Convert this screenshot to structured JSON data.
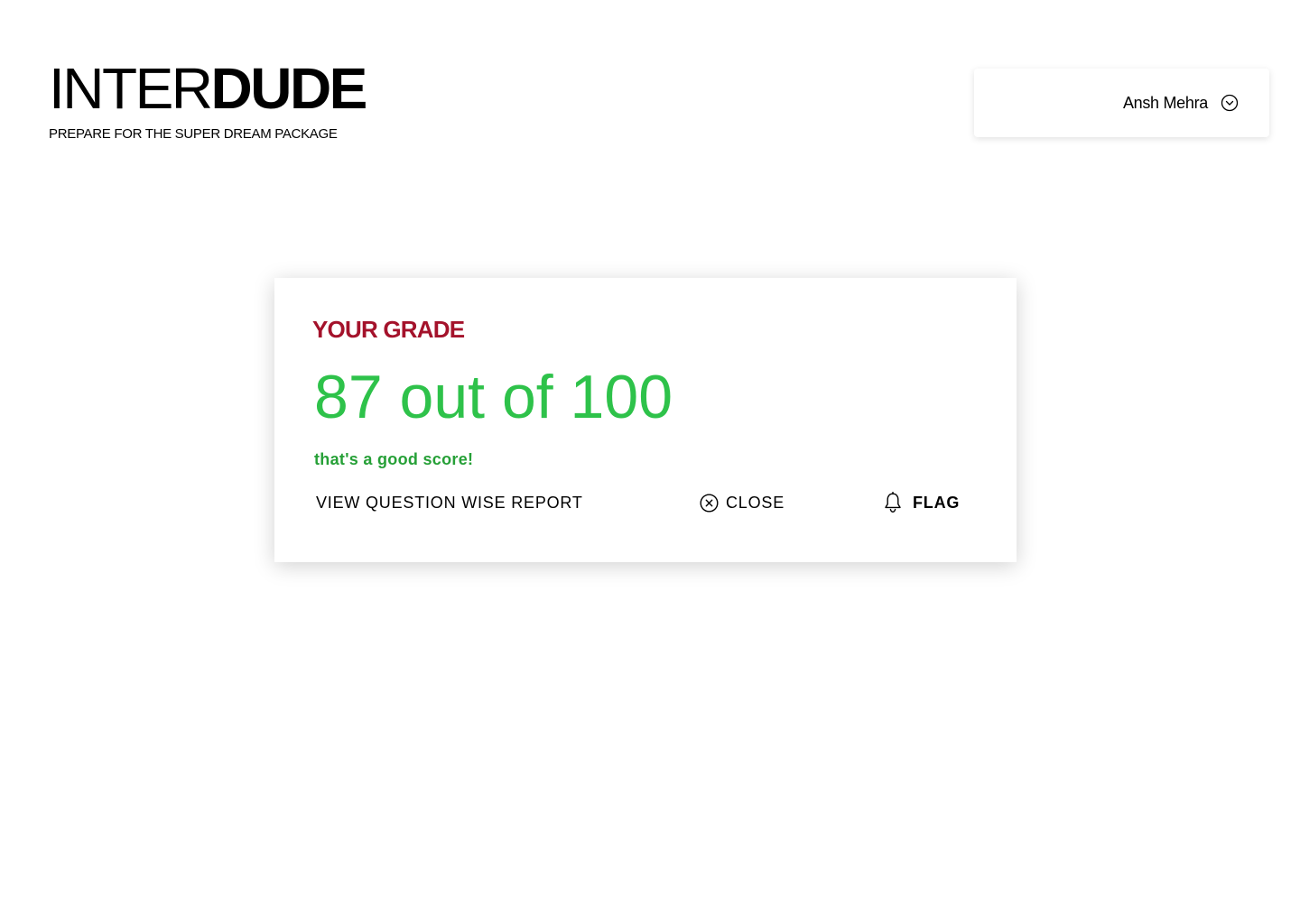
{
  "header": {
    "logo_light": "INTER",
    "logo_bold": "DUDE",
    "tagline": "PREPARE FOR THE SUPER DREAM PACKAGE"
  },
  "user": {
    "name": "Ansh Mehra",
    "menu_icon": "chevron-down-circle-icon"
  },
  "grade_card": {
    "title": "YOUR GRADE",
    "score_text": "87 out of 100",
    "remark": "that's a good score!",
    "actions": {
      "report_label": "VIEW QUESTION WISE REPORT",
      "close_label": "CLOSE",
      "close_icon": "close-circle-icon",
      "flag_label": "FLAG",
      "flag_icon": "bell-icon"
    }
  },
  "colors": {
    "title_red": "#a4122b",
    "score_green": "#2ec24a",
    "remark_green": "#26a037"
  }
}
